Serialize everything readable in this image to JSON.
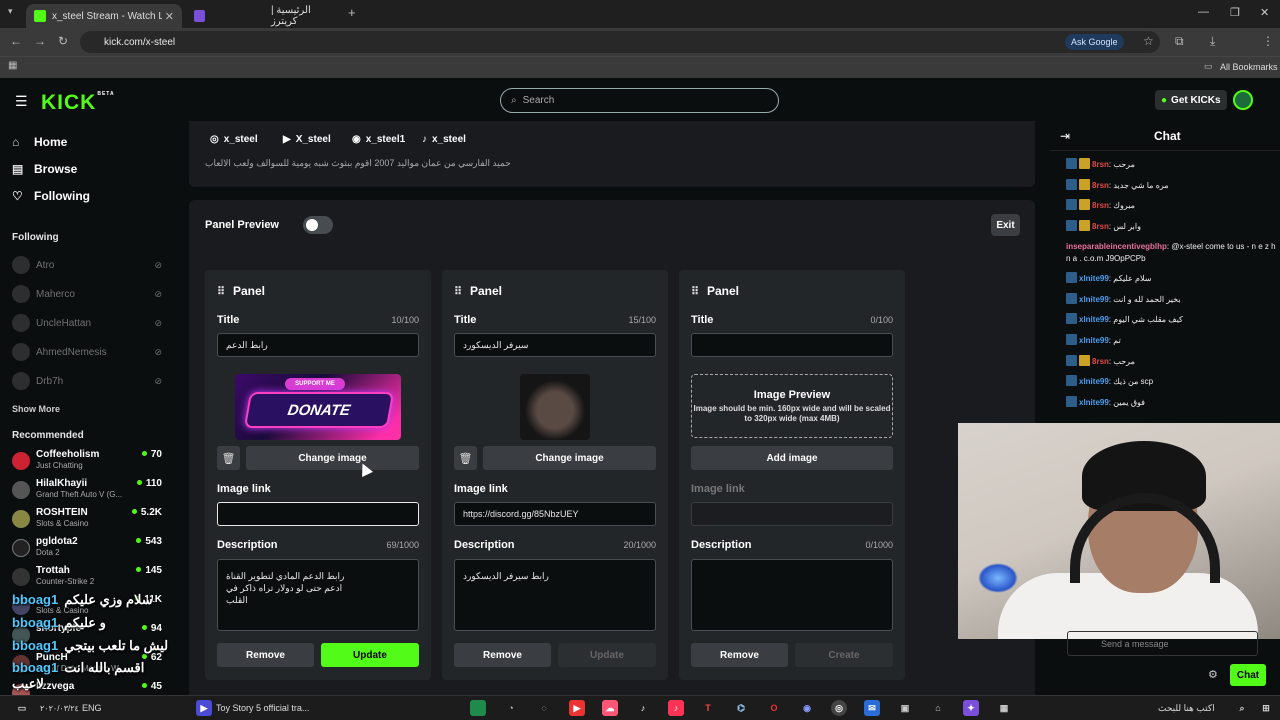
{
  "browser": {
    "tabs": [
      {
        "label": "x_steel Stream - Watch Live on Kick",
        "active": true
      },
      {
        "label": "الرئيسية | كريترز",
        "active": false
      }
    ],
    "url": "kick.com/x-steel",
    "ask_google": "Ask Google",
    "all_bookmarks": "All Bookmarks"
  },
  "header": {
    "logo": "KICK",
    "logo_badge": "BETA",
    "search_placeholder": "Search",
    "get_kicks": "Get KICKs"
  },
  "sidebar": {
    "nav": [
      {
        "label": "Home",
        "icon": "home-icon"
      },
      {
        "label": "Browse",
        "icon": "browse-icon"
      },
      {
        "label": "Following",
        "icon": "heart-icon"
      }
    ],
    "following_title": "Following",
    "following": [
      "Atro",
      "Maherco",
      "UncleHattan",
      "AhmedNemesis",
      "Drb7h"
    ],
    "show_more": "Show More",
    "recommended_title": "Recommended",
    "recommended": [
      {
        "name": "Coffeeholism",
        "category": "Just Chatting",
        "viewers": "70"
      },
      {
        "name": "HilalKhayii",
        "category": "Grand Theft Auto V (G...",
        "viewers": "110"
      },
      {
        "name": "ROSHTEIN",
        "category": "Slots & Casino",
        "viewers": "5.2K"
      },
      {
        "name": "pgldota2",
        "category": "Dota 2",
        "viewers": "543"
      },
      {
        "name": "Trottah",
        "category": "Counter-Strike 2",
        "viewers": "145"
      },
      {
        "name": "bboag1",
        "category": "Slots & Casino",
        "viewers": "11K"
      },
      {
        "name": "shortyple",
        "category": "",
        "viewers": "94"
      },
      {
        "name": "PuncH",
        "category": "Call of Duty: Modern W...",
        "viewers": "62"
      },
      {
        "name": "lizzvega",
        "category": "",
        "viewers": "45"
      }
    ]
  },
  "overlay_chat": [
    {
      "user": "bboag1",
      "text": "سلام وزي عليكم"
    },
    {
      "user": "bboag1",
      "text": "و عليكم"
    },
    {
      "user": "bboag1",
      "text": "ليش ما تلعب بيتجي"
    },
    {
      "user": "bboag1",
      "text": "اقسم بالله انت لاعيب"
    }
  ],
  "profile": {
    "socials": [
      {
        "icon": "instagram-icon",
        "label": "x_steel"
      },
      {
        "icon": "youtube-icon",
        "label": "X_steel"
      },
      {
        "icon": "discord-icon",
        "label": "x_steel1"
      },
      {
        "icon": "tiktok-icon",
        "label": "x_steel"
      }
    ],
    "bio": "حميد الفارسي من عمان مواليد 2007 اقوم ببثوث شبه يومية للسوالف ولعب الالعاب"
  },
  "panel_preview": {
    "label": "Panel Preview",
    "exit": "Exit"
  },
  "panels": [
    {
      "title": "Panel",
      "title_label": "Title",
      "title_count": "10/100",
      "title_value": "رابط الدعم",
      "image_type": "donate",
      "image_text_top": "SUPPORT ME",
      "image_text": "DONATE",
      "image_button": "Change image",
      "image_link_label": "Image link",
      "image_link_value": "",
      "description_label": "Description",
      "description_count": "69/1000",
      "description_value": "رابط الدعم المادي لتطوير القناة ادعم حتى لو دولار تراه ذاكر في القلب",
      "remove": "Remove",
      "update": "Update"
    },
    {
      "title": "Panel",
      "title_label": "Title",
      "title_count": "15/100",
      "title_value": "سيرفر الديسكورد",
      "image_type": "photo",
      "image_button": "Change image",
      "image_link_label": "Image link",
      "image_link_value": "https://discord.gg/85NbzUEY",
      "description_label": "Description",
      "description_count": "20/1000",
      "description_value": "رابط سيرفر الديسكورد",
      "remove": "Remove",
      "update": "Update"
    },
    {
      "title": "Panel",
      "title_label": "Title",
      "title_count": "0/100",
      "title_value": "",
      "image_type": "empty",
      "preview_title": "Image Preview",
      "preview_text": "Image should be min. 160px wide and will be scaled to 320px wide (max 4MB)",
      "image_button": "Add image",
      "image_link_label": "Image link",
      "image_link_value": "",
      "description_label": "Description",
      "description_count": "0/1000",
      "description_value": "",
      "remove": "Remove",
      "update": "Create"
    }
  ],
  "chat": {
    "title": "Chat",
    "messages": [
      {
        "user": "8rsn",
        "color": "#e04848",
        "text": "مرحب",
        "badges": 2
      },
      {
        "user": "8rsn",
        "color": "#e04848",
        "text": "مره ما شي جديد",
        "badges": 2
      },
      {
        "user": "8rsn",
        "color": "#e04848",
        "text": "مبروك",
        "badges": 2
      },
      {
        "user": "8rsn",
        "color": "#e04848",
        "text": "وابر لس",
        "badges": 2
      },
      {
        "user": "inseparableincentivegblhp",
        "color": "#e8709a",
        "text": "@x-steel come to us - n e z h n a . c.o.m J9OpPCPb",
        "badges": 0
      },
      {
        "user": "xlnite99",
        "color": "#4a9ff0",
        "text": "سلام عليكم",
        "badges": 1
      },
      {
        "user": "xlnite99",
        "color": "#4a9ff0",
        "text": "بخير الحمد لله و انت",
        "badges": 1
      },
      {
        "user": "xlnite99",
        "color": "#4a9ff0",
        "text": "كيف مقلب شي اليوم",
        "badges": 1
      },
      {
        "user": "xlnite99",
        "color": "#4a9ff0",
        "text": "تم",
        "badges": 1
      },
      {
        "user": "8rsn",
        "color": "#e04848",
        "text": "مرحب",
        "badges": 2
      },
      {
        "user": "xlnite99",
        "color": "#4a9ff0",
        "text": "من ذيك scp",
        "badges": 1
      },
      {
        "user": "xlnite99",
        "color": "#4a9ff0",
        "text": "فوق يمين",
        "badges": 1
      }
    ],
    "send_placeholder": "Send a message",
    "chat_button": "Chat"
  },
  "taskbar": {
    "media_title": "Toy Story 5 official tra...",
    "lang": "ENG",
    "search_text": "اكتب هنا للبحث",
    "date": "٢٠٢٠/٠٣/٢٤"
  },
  "colors": {
    "accent": "#53fc18",
    "panel_bg": "#232629",
    "section_bg": "#191b1f"
  }
}
